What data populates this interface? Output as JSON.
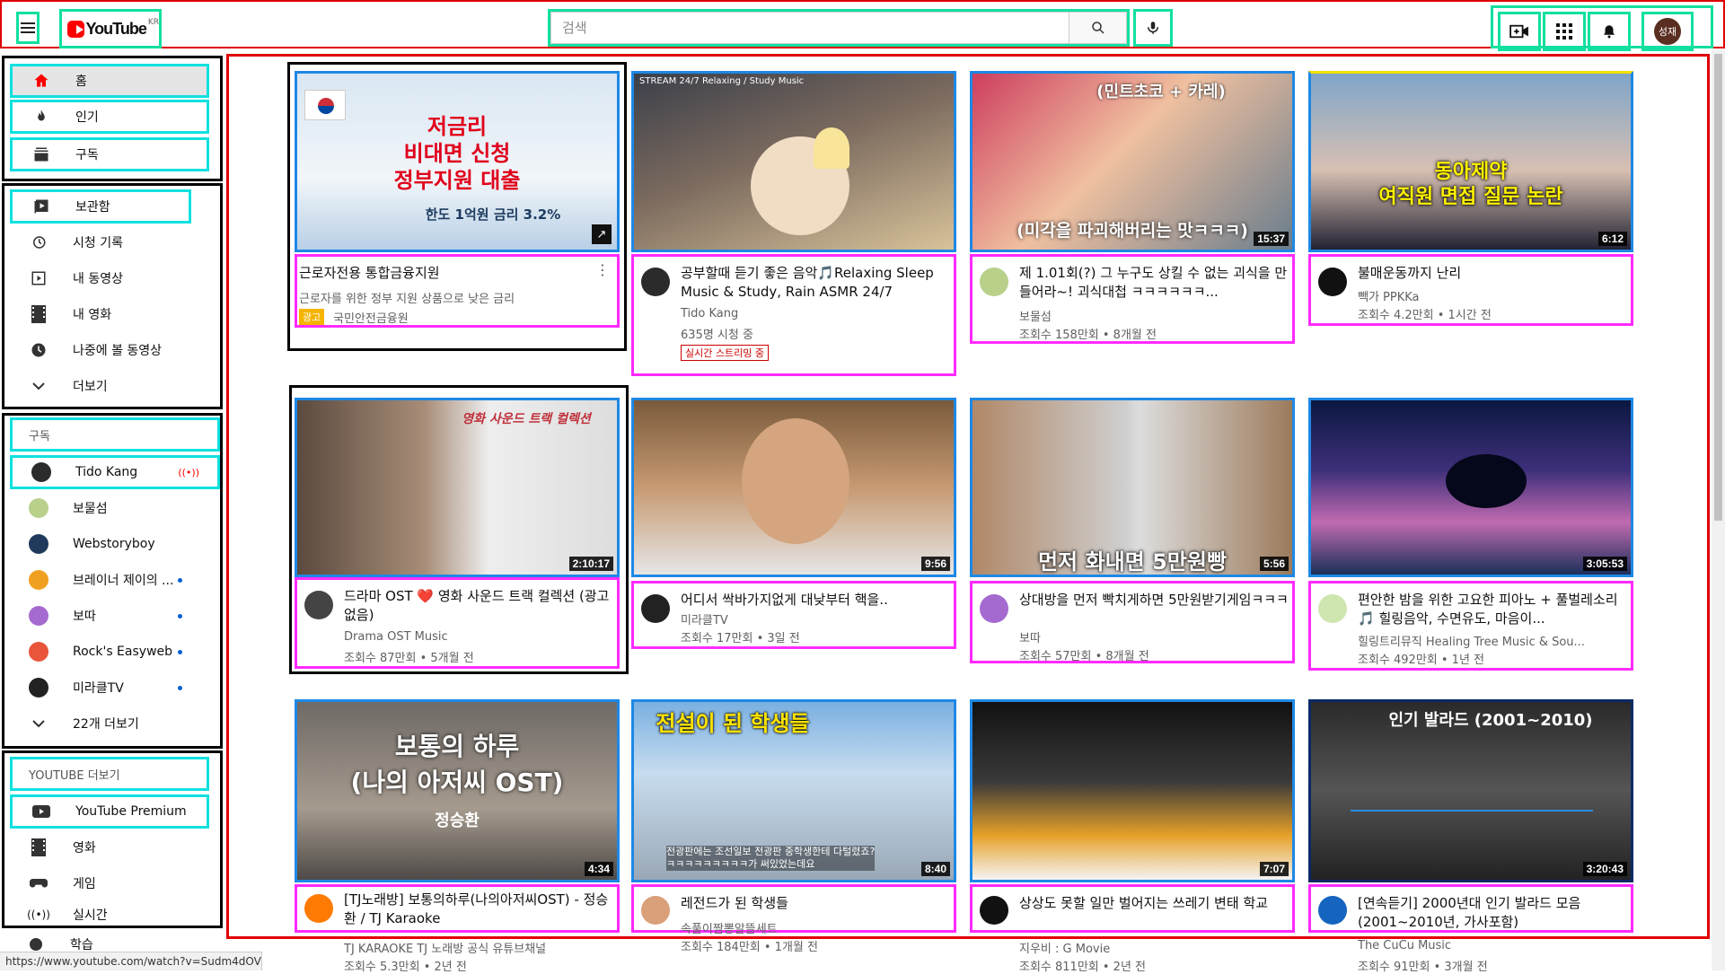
{
  "header": {
    "logo_text": "YouTube",
    "logo_region": "KR",
    "search_placeholder": "검색",
    "avatar_text": "성재"
  },
  "sidebar": {
    "main": [
      {
        "label": "홈",
        "icon": "home-icon"
      },
      {
        "label": "인기",
        "icon": "fire-icon"
      },
      {
        "label": "구독",
        "icon": "subscriptions-icon"
      }
    ],
    "library": [
      {
        "label": "보관함",
        "icon": "library-icon"
      },
      {
        "label": "시청 기록",
        "icon": "history-icon"
      },
      {
        "label": "내 동영상",
        "icon": "my-videos-icon"
      },
      {
        "label": "내 영화",
        "icon": "movie-icon"
      },
      {
        "label": "나중에 볼 동영상",
        "icon": "clock-icon"
      },
      {
        "label": "더보기",
        "icon": "chevron-down-icon"
      }
    ],
    "subscriptions_header": "구독",
    "subscriptions": [
      {
        "label": "Tido Kang",
        "color": "#2b2b2b"
      },
      {
        "label": "보물섬",
        "color": "#b8d08a"
      },
      {
        "label": "Webstoryboy",
        "color": "#1f3a5a"
      },
      {
        "label": "브레이너 제이의 ...",
        "color": "#f0a020"
      },
      {
        "label": "보따",
        "color": "#a56ad0"
      },
      {
        "label": "Rock's Easyweb",
        "color": "#e8553a"
      },
      {
        "label": "미라클TV",
        "color": "#222222"
      }
    ],
    "more_subs": "22개 더보기",
    "more_youtube_header": "YOUTUBE 더보기",
    "more_youtube": [
      {
        "label": "YouTube Premium",
        "icon": "youtube-icon"
      },
      {
        "label": "영화",
        "icon": "movie-icon"
      },
      {
        "label": "게임",
        "icon": "game-icon"
      },
      {
        "label": "실시간",
        "icon": "live-icon"
      },
      {
        "label": "학습",
        "icon": "learn-icon"
      }
    ]
  },
  "videos": [
    {
      "title": "근로자전용 통합금융지원",
      "channel": "근로자를 위한 정부 지원 상품으로 낮은 금리",
      "stats": "국민안전금융원",
      "ad_badge": "광고",
      "duration": "",
      "thumb_text": "저금리\n비대면 신청\n정부지원 대출",
      "thumb_sub": "한도 1억원  금리 3.2%"
    },
    {
      "title": "공부할때 듣기 좋은 음악🎵Relaxing Sleep Music & Study, Rain ASMR 24/7",
      "channel": "Tido Kang",
      "stats": "635명 시청 중",
      "live_badge": "실시간 스트리밍 중",
      "duration": "",
      "thumb_text": "STREAM 24/7 Relaxing / Study Music"
    },
    {
      "title": "제 1.01회(?) 그 누구도 상킬 수 없는 괴식을 만들어라~! 괴식대첩 ㅋㅋㅋㅋㅋㅋ...",
      "channel": "보물섬",
      "stats": "조회수 158만회 • 8개월 전",
      "duration": "15:37",
      "thumb_text": "(민트초코 + 카레)",
      "thumb_sub": "(미각을 파괴해버리는 맛ㅋㅋㅋ)"
    },
    {
      "title": "불매운동까지 난리",
      "channel": "빽가 PPKKa",
      "stats": "조회수 4.2만회 • 1시간 전",
      "duration": "6:12",
      "thumb_text": "동아제약\n여직원 면접 질문 논란"
    },
    {
      "title": "드라마 OST ❤️ 영화 사운드 트랙 컬렉션 (광고 없음)",
      "channel": "Drama OST Music",
      "stats": "조회수 87만회 • 5개월 전",
      "duration": "2:10:17",
      "thumb_text": "영화 사운드 트랙 컬렉션"
    },
    {
      "title": "어디서 싹바가지없게 대낮부터 핵을..",
      "channel": "미라클TV",
      "stats": "조회수 17만회 • 3일 전",
      "duration": "9:56",
      "thumb_text": ""
    },
    {
      "title": "상대방을 먼저 빡치게하면 5만원받기게임ㅋㅋㅋ",
      "channel": "보따",
      "stats": "조회수 57만회 • 8개월 전",
      "duration": "5:56",
      "thumb_text": "먼저 화내면 5만원빵"
    },
    {
      "title": "편안한 밤을 위한 고요한 피아노 + 풀벌레소리 🎵 힐링음악, 수면유도, 마음이...",
      "channel": "힐링트리뮤직 Healing Tree Music & Sou...",
      "stats": "조회수 492만회 • 1년 전",
      "duration": "3:05:53",
      "thumb_text": ""
    },
    {
      "title": "[TJ노래방] 보통의하루(나의아저씨OST) - 정승환 / TJ Karaoke",
      "channel": "TJ KARAOKE TJ 노래방 공식 유튜브채널",
      "stats": "조회수 5.3만회 • 2년 전",
      "duration": "4:34",
      "thumb_text": "보통의 하루\n(나의 아저씨 OST)",
      "thumb_sub": "정승환"
    },
    {
      "title": "레전드가 된 학생들",
      "channel": "속풀이짬뽕알뜰세트",
      "stats": "조회수 184만회 • 1개월 전",
      "duration": "8:40",
      "thumb_text": "전설이 된 학생들",
      "thumb_sub": "전광판에는 조선일보 전광판 중학생한테 다털렸죠?\nㅋㅋㅋㅋㅋㅋㅋㅋㅋ가 써있었는데요"
    },
    {
      "title": "상상도 못할 일만 벌어지는 쓰레기 변태 학교",
      "channel": "지우비 : G Movie",
      "stats": "조회수 811만회 • 2년 전",
      "duration": "7:07",
      "thumb_text": ""
    },
    {
      "title": "[연속듣기] 2000년대 인기 발라드 모음 (2001~2010년, 가사포함)",
      "channel": "The CuCu Music",
      "stats": "조회수 91만회 • 3개월 전",
      "duration": "3:20:43",
      "thumb_text": "인기 발라드 (2001~2010)"
    }
  ],
  "status_url": "https://www.youtube.com/watch?v=Sudm4dOV8_g",
  "colors": {
    "brand_red": "#ff0000",
    "annotation_red": "#e00000",
    "annotation_cyan": "#11e0e0",
    "annotation_blue": "#1e88e5",
    "annotation_magenta": "#ff2aff"
  }
}
